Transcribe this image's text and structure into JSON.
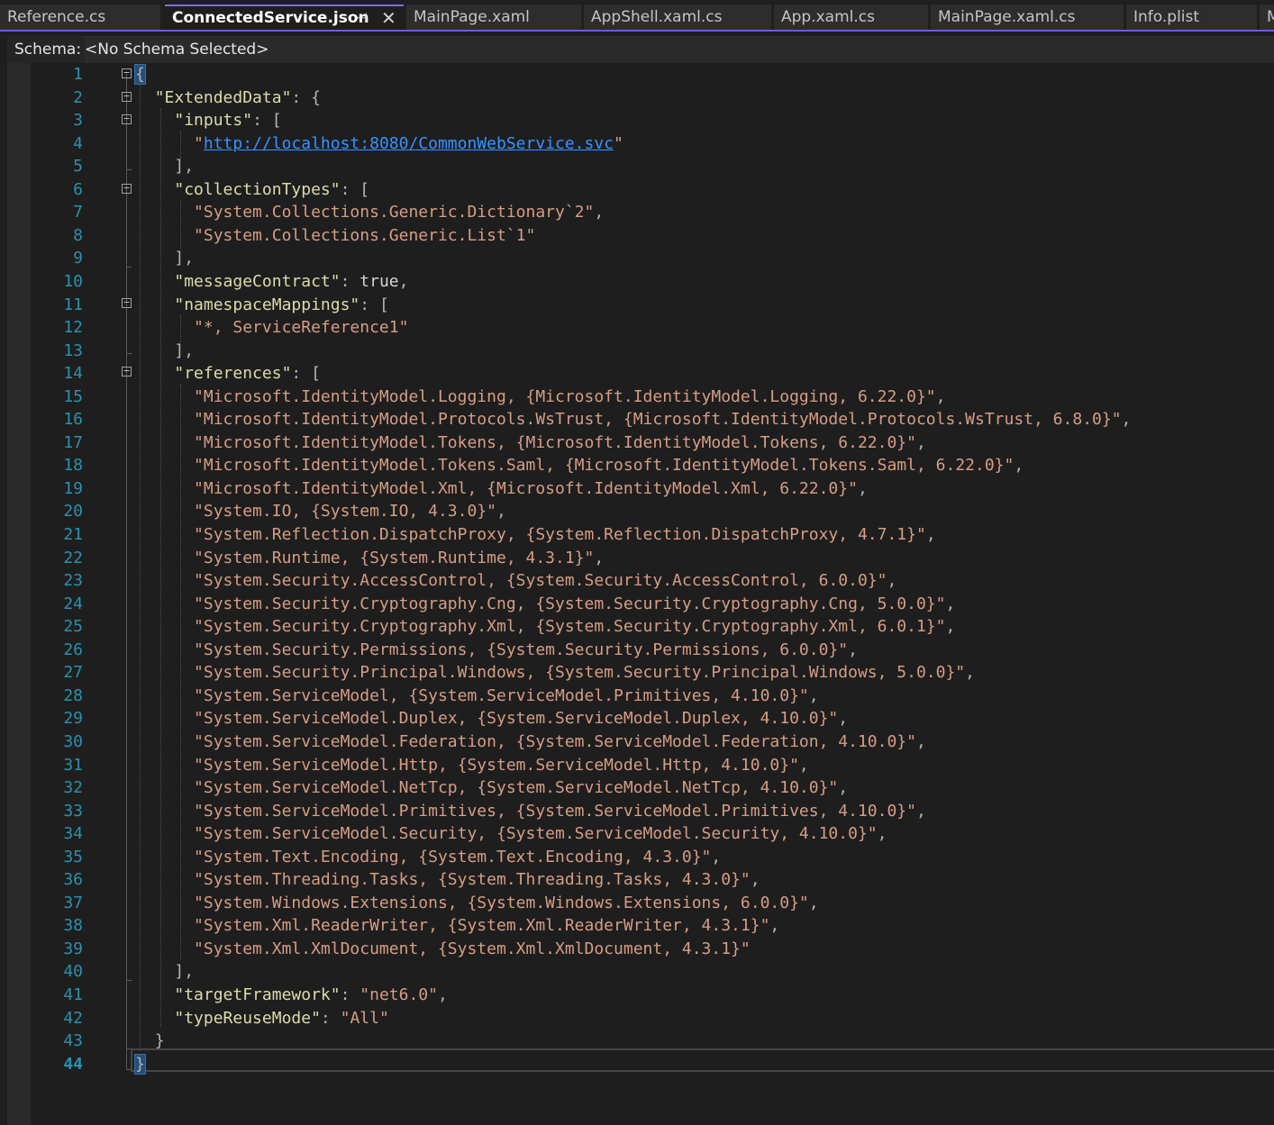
{
  "tabs": [
    {
      "label": "Reference.cs",
      "active": false
    },
    {
      "label": "ConnectedService.json",
      "active": true
    },
    {
      "label": "MainPage.xaml",
      "active": false
    },
    {
      "label": "AppShell.xaml.cs",
      "active": false
    },
    {
      "label": "App.xaml.cs",
      "active": false
    },
    {
      "label": "MainPage.xaml.cs",
      "active": false
    },
    {
      "label": "Info.plist",
      "active": false
    },
    {
      "label": "M",
      "active": false
    }
  ],
  "tab_icons": {
    "pin": "pin-icon",
    "close": "close-icon"
  },
  "schema": {
    "label": "Schema:",
    "value": "<No Schema Selected>"
  },
  "editor": {
    "current_line": 44,
    "lines": [
      "{",
      "  \"ExtendedData\": {",
      "    \"inputs\": [",
      "      \"http://localhost:8080/CommonWebService.svc\"",
      "    ],",
      "    \"collectionTypes\": [",
      "      \"System.Collections.Generic.Dictionary`2\",",
      "      \"System.Collections.Generic.List`1\"",
      "    ],",
      "    \"messageContract\": true,",
      "    \"namespaceMappings\": [",
      "      \"*, ServiceReference1\"",
      "    ],",
      "    \"references\": [",
      "      \"Microsoft.IdentityModel.Logging, {Microsoft.IdentityModel.Logging, 6.22.0}\",",
      "      \"Microsoft.IdentityModel.Protocols.WsTrust, {Microsoft.IdentityModel.Protocols.WsTrust, 6.8.0}\",",
      "      \"Microsoft.IdentityModel.Tokens, {Microsoft.IdentityModel.Tokens, 6.22.0}\",",
      "      \"Microsoft.IdentityModel.Tokens.Saml, {Microsoft.IdentityModel.Tokens.Saml, 6.22.0}\",",
      "      \"Microsoft.IdentityModel.Xml, {Microsoft.IdentityModel.Xml, 6.22.0}\",",
      "      \"System.IO, {System.IO, 4.3.0}\",",
      "      \"System.Reflection.DispatchProxy, {System.Reflection.DispatchProxy, 4.7.1}\",",
      "      \"System.Runtime, {System.Runtime, 4.3.1}\",",
      "      \"System.Security.AccessControl, {System.Security.AccessControl, 6.0.0}\",",
      "      \"System.Security.Cryptography.Cng, {System.Security.Cryptography.Cng, 5.0.0}\",",
      "      \"System.Security.Cryptography.Xml, {System.Security.Cryptography.Xml, 6.0.1}\",",
      "      \"System.Security.Permissions, {System.Security.Permissions, 6.0.0}\",",
      "      \"System.Security.Principal.Windows, {System.Security.Principal.Windows, 5.0.0}\",",
      "      \"System.ServiceModel, {System.ServiceModel.Primitives, 4.10.0}\",",
      "      \"System.ServiceModel.Duplex, {System.ServiceModel.Duplex, 4.10.0}\",",
      "      \"System.ServiceModel.Federation, {System.ServiceModel.Federation, 4.10.0}\",",
      "      \"System.ServiceModel.Http, {System.ServiceModel.Http, 4.10.0}\",",
      "      \"System.ServiceModel.NetTcp, {System.ServiceModel.NetTcp, 4.10.0}\",",
      "      \"System.ServiceModel.Primitives, {System.ServiceModel.Primitives, 4.10.0}\",",
      "      \"System.ServiceModel.Security, {System.ServiceModel.Security, 4.10.0}\",",
      "      \"System.Text.Encoding, {System.Text.Encoding, 4.3.0}\",",
      "      \"System.Threading.Tasks, {System.Threading.Tasks, 4.3.0}\",",
      "      \"System.Windows.Extensions, {System.Windows.Extensions, 6.0.0}\",",
      "      \"System.Xml.ReaderWriter, {System.Xml.ReaderWriter, 4.3.1}\",",
      "      \"System.Xml.XmlDocument, {System.Xml.XmlDocument, 4.3.1}\"",
      "    ],",
      "    \"targetFramework\": \"net6.0\",",
      "    \"typeReuseMode\": \"All\"",
      "  }",
      "}"
    ]
  },
  "colors": {
    "accent": "#6b5fd6",
    "key": "#dcdcaa",
    "string": "#d69d85",
    "boolean": "#569cd6",
    "link": "#3794ff",
    "line_number": "#2b91af"
  }
}
